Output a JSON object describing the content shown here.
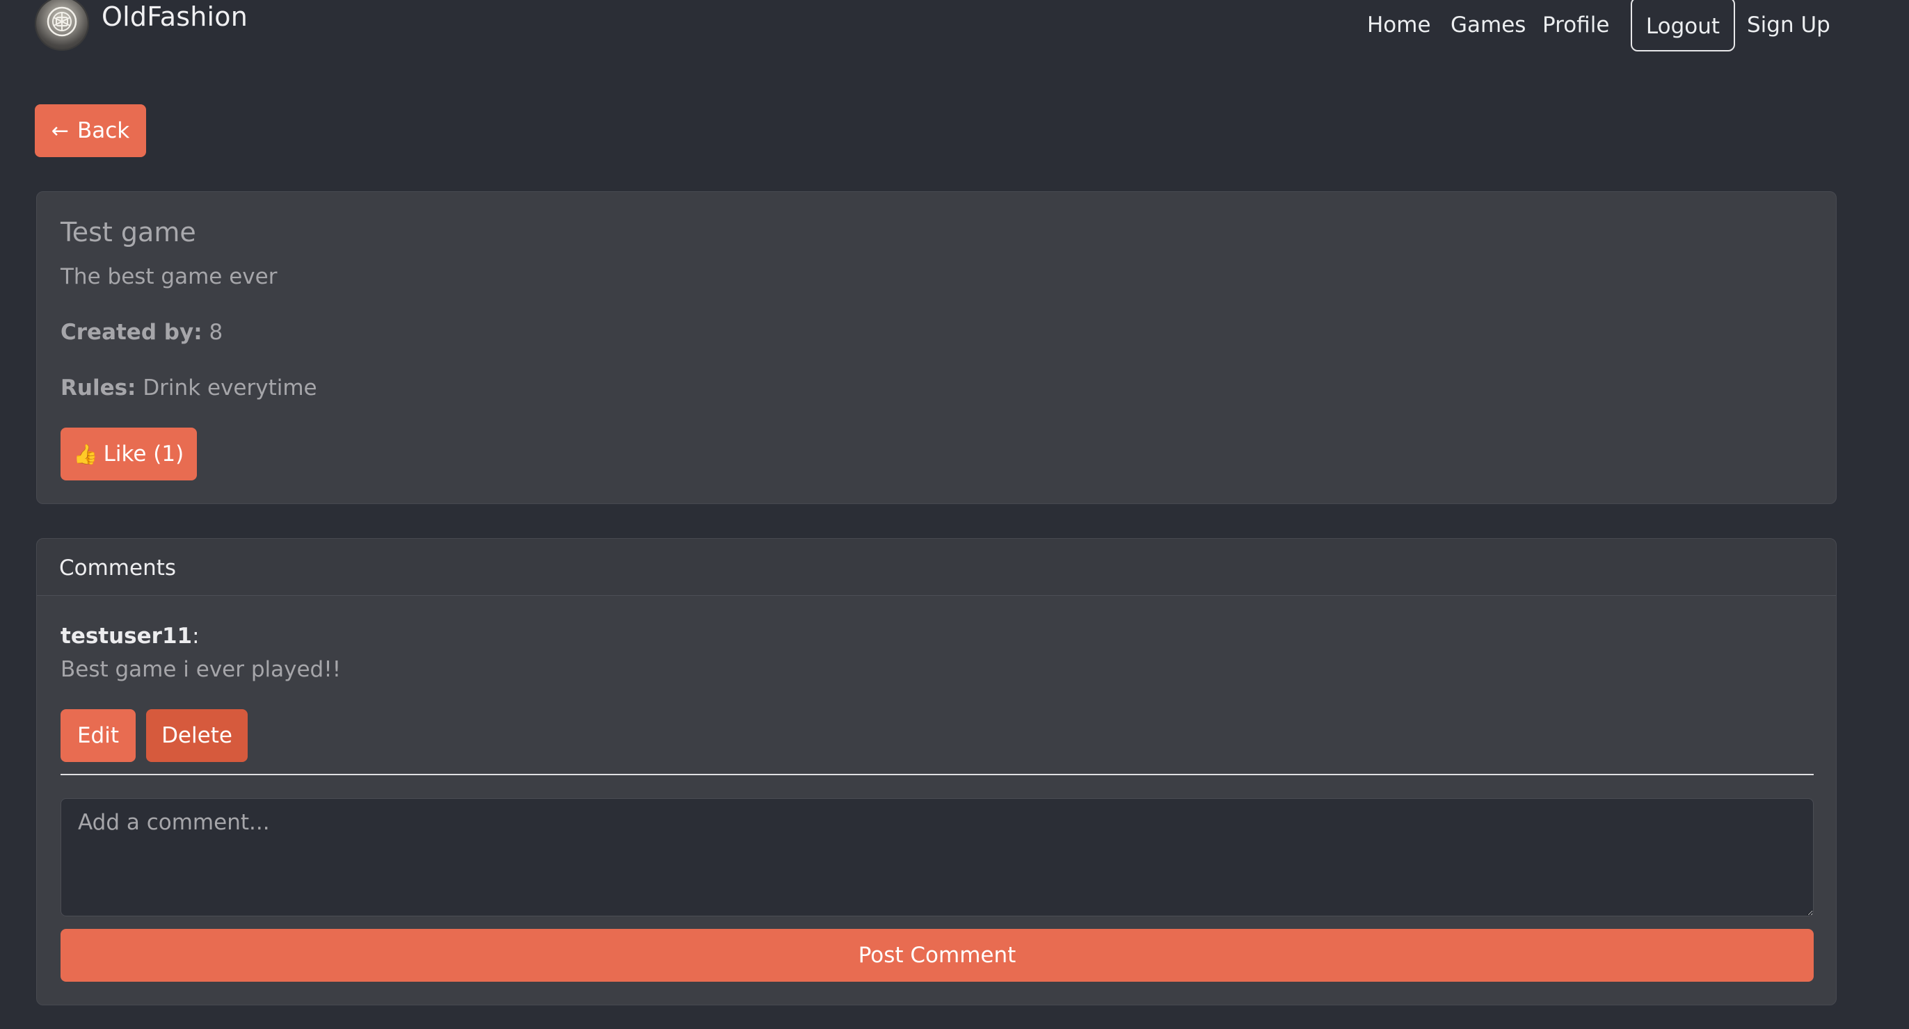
{
  "navbar": {
    "brand_name": "OldFashion",
    "links": {
      "home": "Home",
      "games": "Games",
      "profile": "Profile",
      "logout": "Logout",
      "signup": "Sign Up"
    }
  },
  "back_button": {
    "icon": "arrow-left-icon",
    "label": "Back"
  },
  "game": {
    "title": "Test game",
    "description": "The best game ever",
    "created_by_label": "Created by:",
    "created_by_value": "8",
    "rules_label": "Rules:",
    "rules_value": "Drink everytime",
    "like_label": "Like (1)",
    "like_icon": "thumbs-up-icon"
  },
  "comments": {
    "header": "Comments",
    "items": [
      {
        "author": "testuser11",
        "text": "Best game i ever played!!",
        "edit_label": "Edit",
        "delete_label": "Delete"
      }
    ],
    "input_placeholder": "Add a comment...",
    "post_label": "Post Comment"
  },
  "colors": {
    "background": "#2b2e36",
    "card": "#3d3f45",
    "accent": "#e86c51",
    "danger": "#d65a3d"
  }
}
